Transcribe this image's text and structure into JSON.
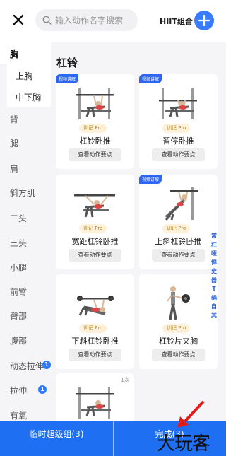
{
  "header": {
    "close_icon": "close-icon",
    "search_placeholder": "输入动作名字搜索",
    "combo_label": "HIIT组合",
    "add_icon": "plus-icon",
    "accent": "#3a7bff"
  },
  "sidebar": {
    "selected": "胸",
    "items": [
      {
        "label": "胸"
      },
      {
        "label": "背"
      },
      {
        "label": "腿"
      },
      {
        "label": "肩"
      },
      {
        "label": "斜方肌"
      },
      {
        "label": "二头"
      },
      {
        "label": "三头"
      },
      {
        "label": "小腿"
      },
      {
        "label": "前臂"
      },
      {
        "label": "臀部"
      },
      {
        "label": "腹部"
      },
      {
        "label": "动态拉伸",
        "badge": "1"
      },
      {
        "label": "拉伸",
        "badge": "1"
      },
      {
        "label": "有氧"
      }
    ],
    "subitems": [
      {
        "label": "上胸"
      },
      {
        "label": "中下胸"
      }
    ]
  },
  "main": {
    "category_title": "杠铃",
    "cards": [
      {
        "name": "杠铃卧推",
        "tag": "视频讲解",
        "pro": "训记 Pro",
        "detail": "查看动作要点"
      },
      {
        "name": "暂停卧推",
        "tag": "视频讲解",
        "pro": "训记 Pro",
        "detail": "查看动作要点"
      },
      {
        "name": "宽距杠铃卧推",
        "tag": "",
        "pro": "训记 Pro",
        "detail": "查看动作要点"
      },
      {
        "name": "上斜杠铃卧推",
        "tag": "视频讲解",
        "pro": "训记 Pro",
        "detail": "查看动作要点"
      },
      {
        "name": "下斜杠铃卧推",
        "tag": "",
        "pro": "训记 Pro",
        "detail": "查看动作要点"
      },
      {
        "name": "杠铃片夹胸",
        "tag": "",
        "pro": "训记 Pro",
        "detail": "查看动作要点"
      },
      {
        "name": "",
        "tag": "",
        "count": "1次"
      }
    ],
    "side_vertical_text": "常杠哑悍史器T绳自其"
  },
  "bottom": {
    "left_label": "临时超级组(3)",
    "right_label": "完成(3)",
    "color": "#1f6ff2"
  },
  "watermark": "大玩客"
}
